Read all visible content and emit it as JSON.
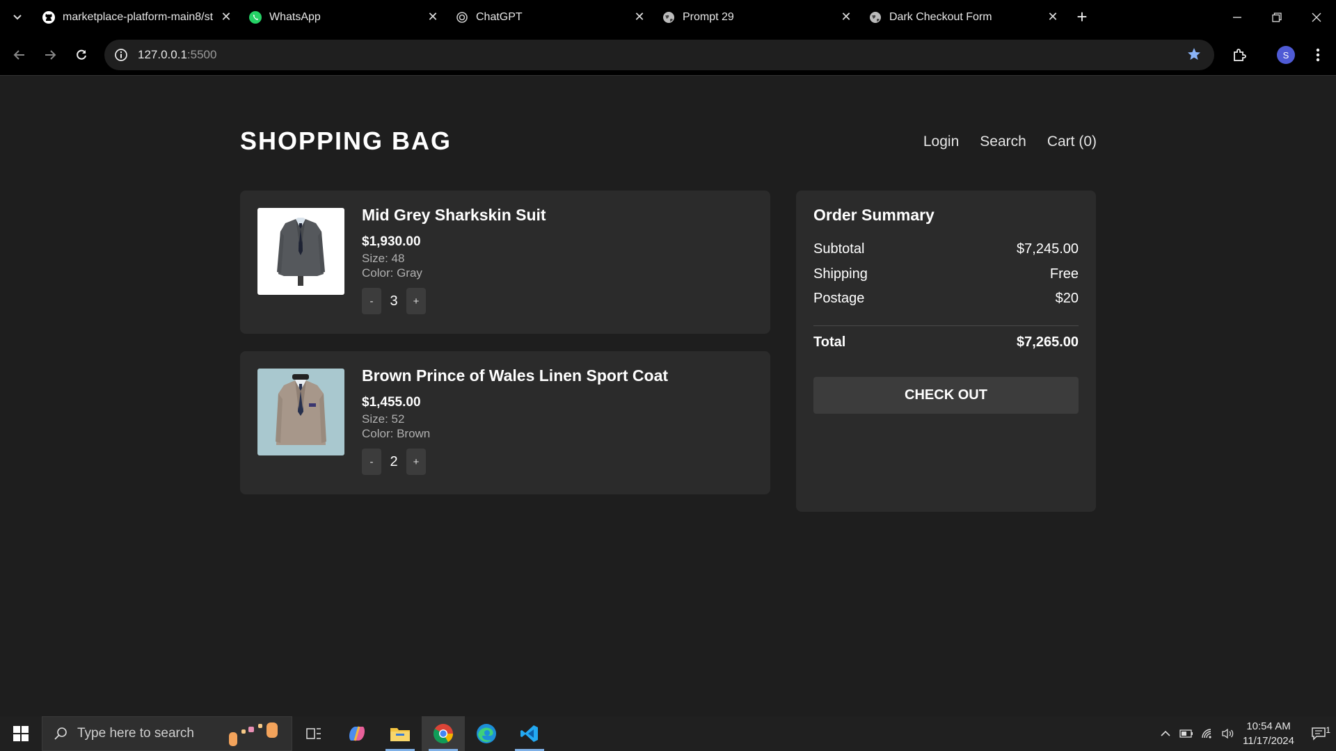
{
  "browser": {
    "tabs": [
      {
        "title": "marketplace-platform-main8/st",
        "icon": "github-icon"
      },
      {
        "title": "WhatsApp",
        "icon": "whatsapp-icon"
      },
      {
        "title": "ChatGPT",
        "icon": "chatgpt-icon"
      },
      {
        "title": "Prompt 29",
        "icon": "globe-icon"
      },
      {
        "title": "Dark Checkout Form",
        "icon": "globe-icon"
      }
    ],
    "url_host": "127.0.0.1",
    "url_port": ":5500",
    "profile_initial": "S"
  },
  "header": {
    "brand": "SHOPPING BAG",
    "nav": {
      "login": "Login",
      "search": "Search",
      "cart": "Cart (0)"
    }
  },
  "items": [
    {
      "name": "Mid Grey Sharkskin Suit",
      "price": "$1,930.00",
      "size": "Size: 48",
      "color": "Color: Gray",
      "qty": "3",
      "minus": "-",
      "plus": "+"
    },
    {
      "name": "Brown Prince of Wales Linen Sport Coat",
      "price": "$1,455.00",
      "size": "Size: 52",
      "color": "Color: Brown",
      "qty": "2",
      "minus": "-",
      "plus": "+"
    }
  ],
  "summary": {
    "title": "Order Summary",
    "subtotal_label": "Subtotal",
    "subtotal": "$7,245.00",
    "shipping_label": "Shipping",
    "shipping": "Free",
    "postage_label": "Postage",
    "postage": "$20",
    "total_label": "Total",
    "total": "$7,265.00",
    "checkout": "CHECK OUT"
  },
  "taskbar": {
    "search_placeholder": "Type here to search",
    "time": "10:54 AM",
    "date": "11/17/2024",
    "notifications": "1"
  },
  "colors": {
    "page_bg": "#1e1e1e",
    "card_bg": "#2b2b2b",
    "button_bg": "#3c3c3c",
    "accent_blue": "#8ab4f8"
  }
}
